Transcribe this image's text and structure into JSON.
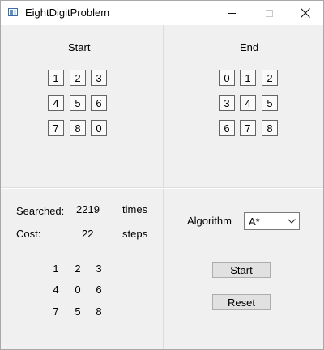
{
  "window": {
    "title": "EightDigitProblem"
  },
  "start": {
    "title": "Start",
    "grid": [
      [
        "1",
        "2",
        "3"
      ],
      [
        "4",
        "5",
        "6"
      ],
      [
        "7",
        "8",
        "0"
      ]
    ]
  },
  "end": {
    "title": "End",
    "grid": [
      [
        "0",
        "1",
        "2"
      ],
      [
        "3",
        "4",
        "5"
      ],
      [
        "6",
        "7",
        "8"
      ]
    ]
  },
  "stats": {
    "searched_label": "Searched:",
    "searched_value": "2219",
    "searched_unit": "times",
    "cost_label": "Cost:",
    "cost_value": "22",
    "cost_unit": "steps"
  },
  "result": {
    "grid": [
      [
        "1",
        "2",
        "3"
      ],
      [
        "4",
        "0",
        "6"
      ],
      [
        "7",
        "5",
        "8"
      ]
    ]
  },
  "controls": {
    "algorithm_label": "Algorithm",
    "algorithm_selected": "A*",
    "start_button": "Start",
    "reset_button": "Reset"
  },
  "icons": {
    "app": "app-window-icon",
    "minimize": "minimize-icon",
    "maximize": "maximize-icon",
    "close": "close-icon",
    "dropdown": "chevron-down-icon"
  }
}
